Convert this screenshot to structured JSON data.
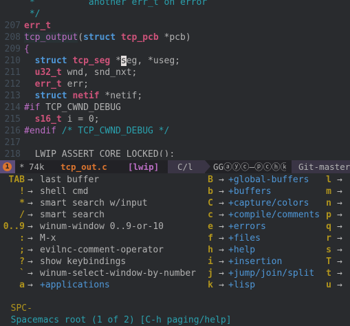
{
  "editor": {
    "lines": [
      {
        "num": "",
        "segments": [
          {
            "t": " *          another err_t on error",
            "c": "com"
          }
        ]
      },
      {
        "num": "",
        "segments": [
          {
            "t": " */",
            "c": "com"
          }
        ]
      },
      {
        "num": "207",
        "segments": [
          {
            "t": "err_t",
            "c": "type"
          }
        ]
      },
      {
        "num": "208",
        "segments": [
          {
            "t": "tcp_output",
            "c": "fnhl"
          },
          {
            "t": "(",
            "c": ""
          },
          {
            "t": "struct",
            "c": "kw"
          },
          {
            "t": " ",
            "c": ""
          },
          {
            "t": "tcp_pcb",
            "c": "type"
          },
          {
            "t": " *pcb)",
            "c": ""
          }
        ]
      },
      {
        "num": "209",
        "segments": [
          {
            "t": "{",
            "c": "pre"
          }
        ]
      },
      {
        "num": "210",
        "segments": [
          {
            "t": "  ",
            "c": ""
          },
          {
            "t": "struct",
            "c": "kw"
          },
          {
            "t": " ",
            "c": ""
          },
          {
            "t": "tcp_seg",
            "c": "type"
          },
          {
            "t": " *",
            "c": ""
          },
          {
            "t": "s",
            "c": "cursor"
          },
          {
            "t": "eg, *useg;",
            "c": ""
          }
        ]
      },
      {
        "num": "211",
        "segments": [
          {
            "t": "  ",
            "c": ""
          },
          {
            "t": "u32_t",
            "c": "type"
          },
          {
            "t": " wnd, snd_nxt;",
            "c": ""
          }
        ]
      },
      {
        "num": "212",
        "segments": [
          {
            "t": "  ",
            "c": ""
          },
          {
            "t": "err_t",
            "c": "type"
          },
          {
            "t": " err;",
            "c": ""
          }
        ]
      },
      {
        "num": "213",
        "segments": [
          {
            "t": "  ",
            "c": ""
          },
          {
            "t": "struct",
            "c": "kw"
          },
          {
            "t": " ",
            "c": ""
          },
          {
            "t": "netif",
            "c": "type"
          },
          {
            "t": " *netif;",
            "c": ""
          }
        ]
      },
      {
        "num": "214",
        "segments": [
          {
            "t": "#if",
            "c": "pre"
          },
          {
            "t": " TCP_CWND_DEBUG",
            "c": ""
          }
        ]
      },
      {
        "num": "215",
        "segments": [
          {
            "t": "  ",
            "c": ""
          },
          {
            "t": "s16_t",
            "c": "type"
          },
          {
            "t": " i = 0;",
            "c": ""
          }
        ]
      },
      {
        "num": "216",
        "segments": [
          {
            "t": "#endif",
            "c": "pre"
          },
          {
            "t": " /* TCP_CWND_DEBUG */",
            "c": "com"
          }
        ]
      },
      {
        "num": "217",
        "segments": []
      },
      {
        "num": "218",
        "segments": [
          {
            "t": "  LWIP_ASSERT_CORE_LOCKED();",
            "c": ""
          }
        ]
      }
    ]
  },
  "modeline": {
    "badge": "1",
    "modified": "*",
    "size": "74k",
    "filename": "tcp_out.c",
    "project": "[lwip]",
    "mode": "C/l",
    "minor_modes": "GGⓐⓨⓒ—ⓟⓒⓗⓚ",
    "vcs": "Git-master",
    "colors": {
      "bg": "#222226",
      "accent": "#5d4d7a",
      "file": "#dc752f",
      "project": "#bc6ec5"
    }
  },
  "which_key": {
    "columns": [
      [
        {
          "key": "TAB",
          "desc": "last buffer",
          "group": false
        },
        {
          "key": "!",
          "desc": "shell cmd",
          "group": false
        },
        {
          "key": "*",
          "desc": "smart search w/input",
          "group": false
        },
        {
          "key": "/",
          "desc": "smart search",
          "group": false
        },
        {
          "key": "0..9",
          "desc": "winum-window 0..9-or-10",
          "group": false
        },
        {
          "key": ":",
          "desc": "M-x",
          "group": false
        },
        {
          "key": ";",
          "desc": "evilnc-comment-operator",
          "group": false
        },
        {
          "key": "?",
          "desc": "show keybindings",
          "group": false
        },
        {
          "key": "`",
          "desc": "winum-select-window-by-number",
          "group": false
        },
        {
          "key": "a",
          "desc": "+applications",
          "group": true
        }
      ],
      [
        {
          "key": "B",
          "desc": "+global-buffers",
          "group": true
        },
        {
          "key": "b",
          "desc": "+buffers",
          "group": true
        },
        {
          "key": "C",
          "desc": "+capture/colors",
          "group": true
        },
        {
          "key": "c",
          "desc": "+compile/comments",
          "group": true
        },
        {
          "key": "e",
          "desc": "+errors",
          "group": true
        },
        {
          "key": "f",
          "desc": "+files",
          "group": true
        },
        {
          "key": "h",
          "desc": "+help",
          "group": true
        },
        {
          "key": "i",
          "desc": "+insertion",
          "group": true
        },
        {
          "key": "j",
          "desc": "+jump/join/split",
          "group": true
        },
        {
          "key": "k",
          "desc": "+lisp",
          "group": true
        }
      ],
      [
        {
          "key": "l",
          "desc": "",
          "group": true
        },
        {
          "key": "m",
          "desc": "",
          "group": true
        },
        {
          "key": "n",
          "desc": "",
          "group": true
        },
        {
          "key": "p",
          "desc": "",
          "group": true
        },
        {
          "key": "q",
          "desc": "",
          "group": true
        },
        {
          "key": "r",
          "desc": "",
          "group": true
        },
        {
          "key": "s",
          "desc": "",
          "group": true
        },
        {
          "key": "T",
          "desc": "",
          "group": true
        },
        {
          "key": "t",
          "desc": "",
          "group": true
        },
        {
          "key": "u",
          "desc": "",
          "group": true
        }
      ]
    ],
    "arrow": "→"
  },
  "echo_area": {
    "prefix": "SPC-",
    "title": "Spacemacs root (1 of 2) [C-h paging/help]"
  }
}
